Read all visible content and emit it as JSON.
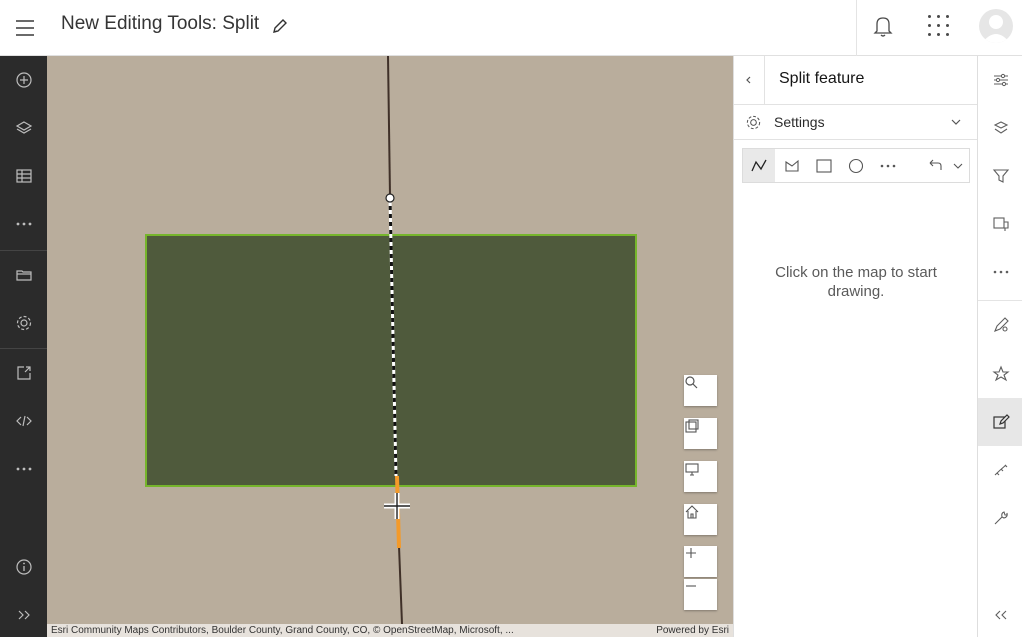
{
  "header": {
    "title": "New Editing Tools: Split"
  },
  "panel": {
    "title": "Split feature",
    "settings_label": "Settings",
    "message": "Click on the map to start drawing."
  },
  "map": {
    "attribution": "Esri Community Maps Contributors, Boulder County, Grand County, CO, © OpenStreetMap, Microsoft, ...",
    "powered_by": "Powered by Esri"
  },
  "left_toolbar": {
    "items": [
      "add-icon",
      "layers-icon",
      "table-icon",
      "more-icon",
      "folder-icon",
      "settings-icon",
      "share-icon",
      "embed-icon",
      "more-icon",
      "info-icon",
      "expand-icon"
    ]
  },
  "right_toolbar": {
    "items": [
      "properties-icon",
      "styles-icon",
      "filter-icon",
      "popups-icon",
      "more-icon",
      "sketch-icon",
      "smart-mapping-icon",
      "edit-icon",
      "measure-icon",
      "tools-icon",
      "collapse-icon"
    ],
    "active": "edit-icon"
  },
  "draw_tools": [
    "polyline-icon",
    "polygon-icon",
    "rectangle-icon",
    "circle-icon",
    "more-icon",
    "undo-icon",
    "chevron-down-icon"
  ],
  "colors": {
    "map_background": "#b9ad9c",
    "polygon_fill": "#4f5a3c",
    "polygon_outline": "#76b52c",
    "split_line": "#ffffff",
    "highlight": "#f39a2a",
    "left_bar": "#2b2b2b"
  }
}
